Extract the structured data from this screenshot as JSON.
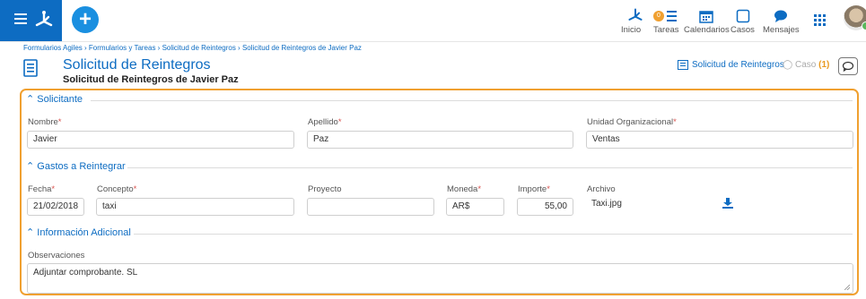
{
  "topbar": {
    "nav": [
      {
        "label": "Inicio",
        "icon": "process-icon"
      },
      {
        "label": "Tareas",
        "icon": "tasks-icon",
        "badge": "0"
      },
      {
        "label": "Calendarios",
        "icon": "calendar-icon"
      },
      {
        "label": "Casos",
        "icon": "cases-icon"
      },
      {
        "label": "Mensajes",
        "icon": "chat-icon"
      }
    ],
    "brand_color": "#0d6cc2",
    "badge_color": "#f0a030"
  },
  "breadcrumb": "Formularios Agiles › Formularios y Tareas › Solicitud de Reintegros › Solicitud de Reintegros de Javier Paz",
  "header": {
    "title": "Solicitud de Reintegros",
    "subtitle": "Solicitud de Reintegros de Javier Paz",
    "form_link": "Solicitud de Reintegros",
    "case_label": "Caso",
    "case_count": "(1)"
  },
  "sections": {
    "solicitante": {
      "title": "Solicitante",
      "nombre_label": "Nombre",
      "nombre_value": "Javier",
      "apellido_label": "Apellido",
      "apellido_value": "Paz",
      "unidad_label": "Unidad Organizacional",
      "unidad_value": "Ventas"
    },
    "gastos": {
      "title": "Gastos a Reintegrar",
      "fecha_label": "Fecha",
      "fecha_value": "21/02/2018",
      "concepto_label": "Concepto",
      "concepto_value": "taxi",
      "proyecto_label": "Proyecto",
      "proyecto_value": "",
      "moneda_label": "Moneda",
      "moneda_value": "AR$",
      "importe_label": "Importe",
      "importe_value": "55,00",
      "archivo_label": "Archivo",
      "archivo_value": "Taxi.jpg"
    },
    "info": {
      "title": "Información Adicional",
      "obs_label": "Observaciones",
      "obs_value": "Adjuntar comprobante. SL"
    }
  },
  "required_marker": "*"
}
